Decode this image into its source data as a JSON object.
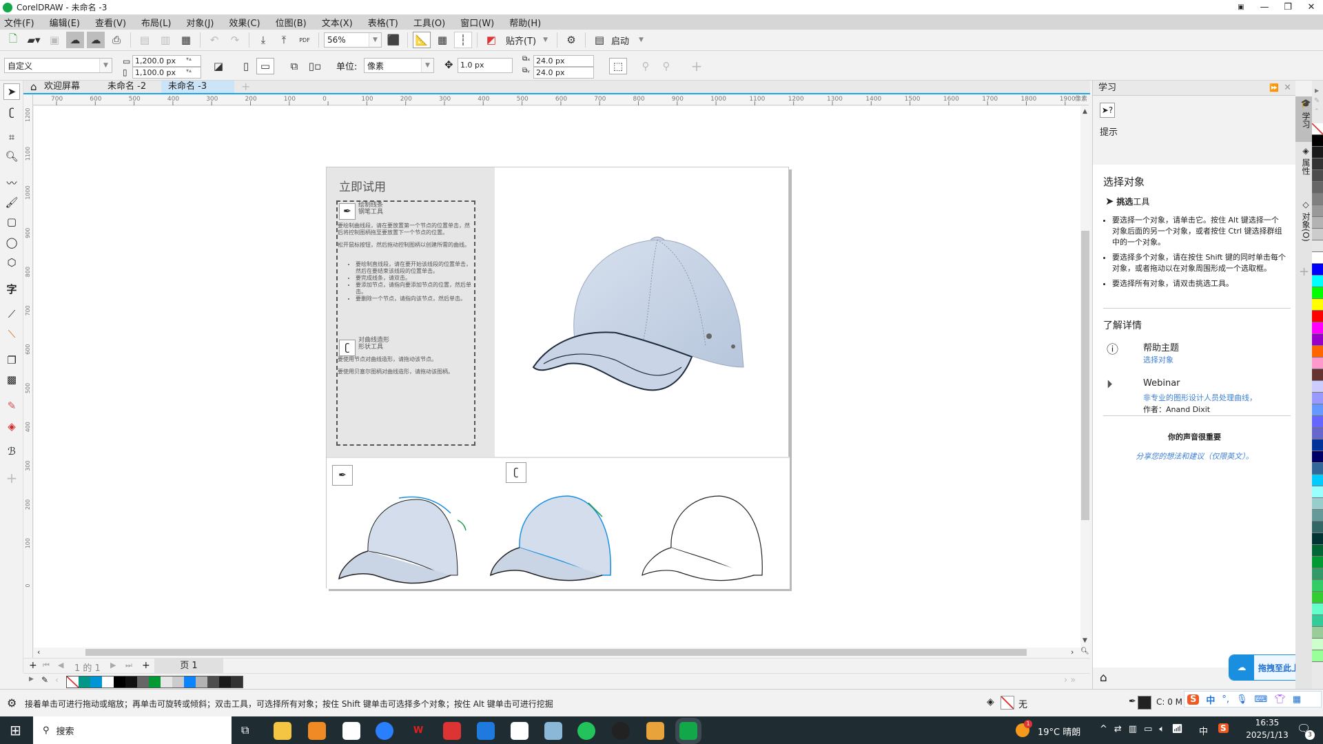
{
  "window": {
    "title": "CorelDRAW - 未命名 -3"
  },
  "menu": [
    "文件(F)",
    "编辑(E)",
    "查看(V)",
    "布局(L)",
    "对象(J)",
    "效果(C)",
    "位图(B)",
    "文本(X)",
    "表格(T)",
    "工具(O)",
    "窗口(W)",
    "帮助(H)"
  ],
  "toolbar": {
    "zoom_value": "56%",
    "snap_label": "贴齐(T)",
    "launch_label": "启动",
    "pdf_label": "PDF"
  },
  "propertybar": {
    "preset": "自定义",
    "width": "1,200.0 px",
    "height": "1,100.0 px",
    "unit_label": "单位:",
    "unit_value": "像素",
    "nudge": "1.0 px",
    "dup_x": "24.0 px",
    "dup_y": "24.0 px"
  },
  "tabs": [
    {
      "label": "欢迎屏幕",
      "active": false
    },
    {
      "label": "未命名 -2",
      "active": false
    },
    {
      "label": "未命名 -3",
      "active": true
    }
  ],
  "ruler": {
    "h_ticks": [
      "700",
      "600",
      "500",
      "400",
      "300",
      "200",
      "100",
      "0",
      "100",
      "200",
      "300",
      "400",
      "500",
      "600",
      "700",
      "800",
      "900",
      "1000",
      "1100",
      "1200",
      "1300",
      "1400",
      "1500",
      "1600",
      "1700",
      "1800",
      "1900"
    ],
    "h_unit": "像素",
    "v_ticks": [
      "1200",
      "1100",
      "1000",
      "900",
      "800",
      "700",
      "600",
      "500",
      "400",
      "300",
      "200",
      "100",
      "0"
    ]
  },
  "document": {
    "heading": "立即试用",
    "pen": {
      "title1": "绘制线条",
      "title2": "钢笔工具",
      "p1": "要绘制曲线段，请在要放置第一个节点的位置单击，然后将控制图柄拖至要放置下一个节点的位置。",
      "p2": "松开鼠标按钮，然后拖动控制图柄以创建所需的曲线。",
      "bullets": [
        "要绘制直线段，请在要开始该线段的位置单击，然后在要结束该线段的位置单击。",
        "要完成线条，请双击。",
        "要添加节点，请指向要添加节点的位置，然后单击。",
        "要删除一个节点，请指向该节点，然后单击。"
      ]
    },
    "shape": {
      "title1": "对曲线造形",
      "title2": "形状工具",
      "p1": "要使用节点对曲线造形，请拖动该节点。",
      "p2": "要使用贝塞尔图柄对曲线造形，请拖动该图柄。"
    }
  },
  "pagebar": {
    "counter": "1 的 1",
    "page_tab": "页 1"
  },
  "doc_palette": [
    "none",
    "#009688",
    "#0096d6",
    "#ffffff",
    "#000000",
    "#111111",
    "#666666",
    "#009933",
    "#e6e6e6",
    "#cccccc",
    "#0a84ff",
    "#b3b3b3",
    "#4d4d4d",
    "#1a1a1a",
    "#333333"
  ],
  "status": {
    "hint": "接着单击可进行拖动或缩放；再单击可旋转或倾斜；双击工具，可选择所有对象；按住 Shift 键单击可选择多个对象；按住 Alt 键单击可进行挖掘",
    "fill_label": "无",
    "outline_label": "C: 0 M"
  },
  "learn": {
    "title": "学习",
    "tips_label": "提示",
    "section_title": "选择对象",
    "tool_bold": "挑选",
    "tool_rest": "工具",
    "bullets": [
      "要选择一个对象，请单击它。按住 Alt 键选择一个对象后面的另一个对象，或者按住 Ctrl 键选择群组中的一个对象。",
      "要选择多个对象，请在按住 Shift 键的同时单击每个对象，或者拖动以在对象周围形成一个选取框。",
      "要选择所有对象，请双击挑选工具。"
    ],
    "more_title": "了解详情",
    "help_topic": "帮助主题",
    "help_link": "选择对象",
    "webinar": "Webinar",
    "webinar_link": "非专业的图形设计人员处理曲线，",
    "webinar_author": "作者：Anand Dixit",
    "feedback_title": "你的声音很重要",
    "feedback_link": "分享您的想法和建议（仅限英文）。",
    "upload_badge": "拖拽至此上传"
  },
  "dockers": [
    "学习",
    "属性",
    "对象(O)"
  ],
  "color_palette": [
    "none",
    "#000000",
    "#1a1a1a",
    "#333333",
    "#4d4d4d",
    "#666666",
    "#808080",
    "#999999",
    "#b3b3b3",
    "#cccccc",
    "#e6e6e6",
    "#ffffff",
    "#0000ff",
    "#00ffff",
    "#00ff00",
    "#ffff00",
    "#ff0000",
    "#ff00ff",
    "#9900cc",
    "#ff6600",
    "#ff99cc",
    "#663333",
    "#ccccff",
    "#9999ff",
    "#6699ff",
    "#6666ff",
    "#6666cc",
    "#003399",
    "#000066",
    "#336699",
    "#00ccff",
    "#99ffff",
    "#99cccc",
    "#669999",
    "#336666",
    "#003333",
    "#006633",
    "#009933",
    "#339966",
    "#33cc66",
    "#33cc33",
    "#66ffcc",
    "#33cc99",
    "#99cc99",
    "#ccffcc",
    "#99ff99"
  ],
  "taskbar": {
    "search": "搜索",
    "weather": "19°C  晴朗",
    "time": "16:35",
    "date": "2025/1/13",
    "ime": "中",
    "notif_count": "3",
    "weather_badge": "1"
  },
  "ime_bar": {
    "lang": "中"
  }
}
